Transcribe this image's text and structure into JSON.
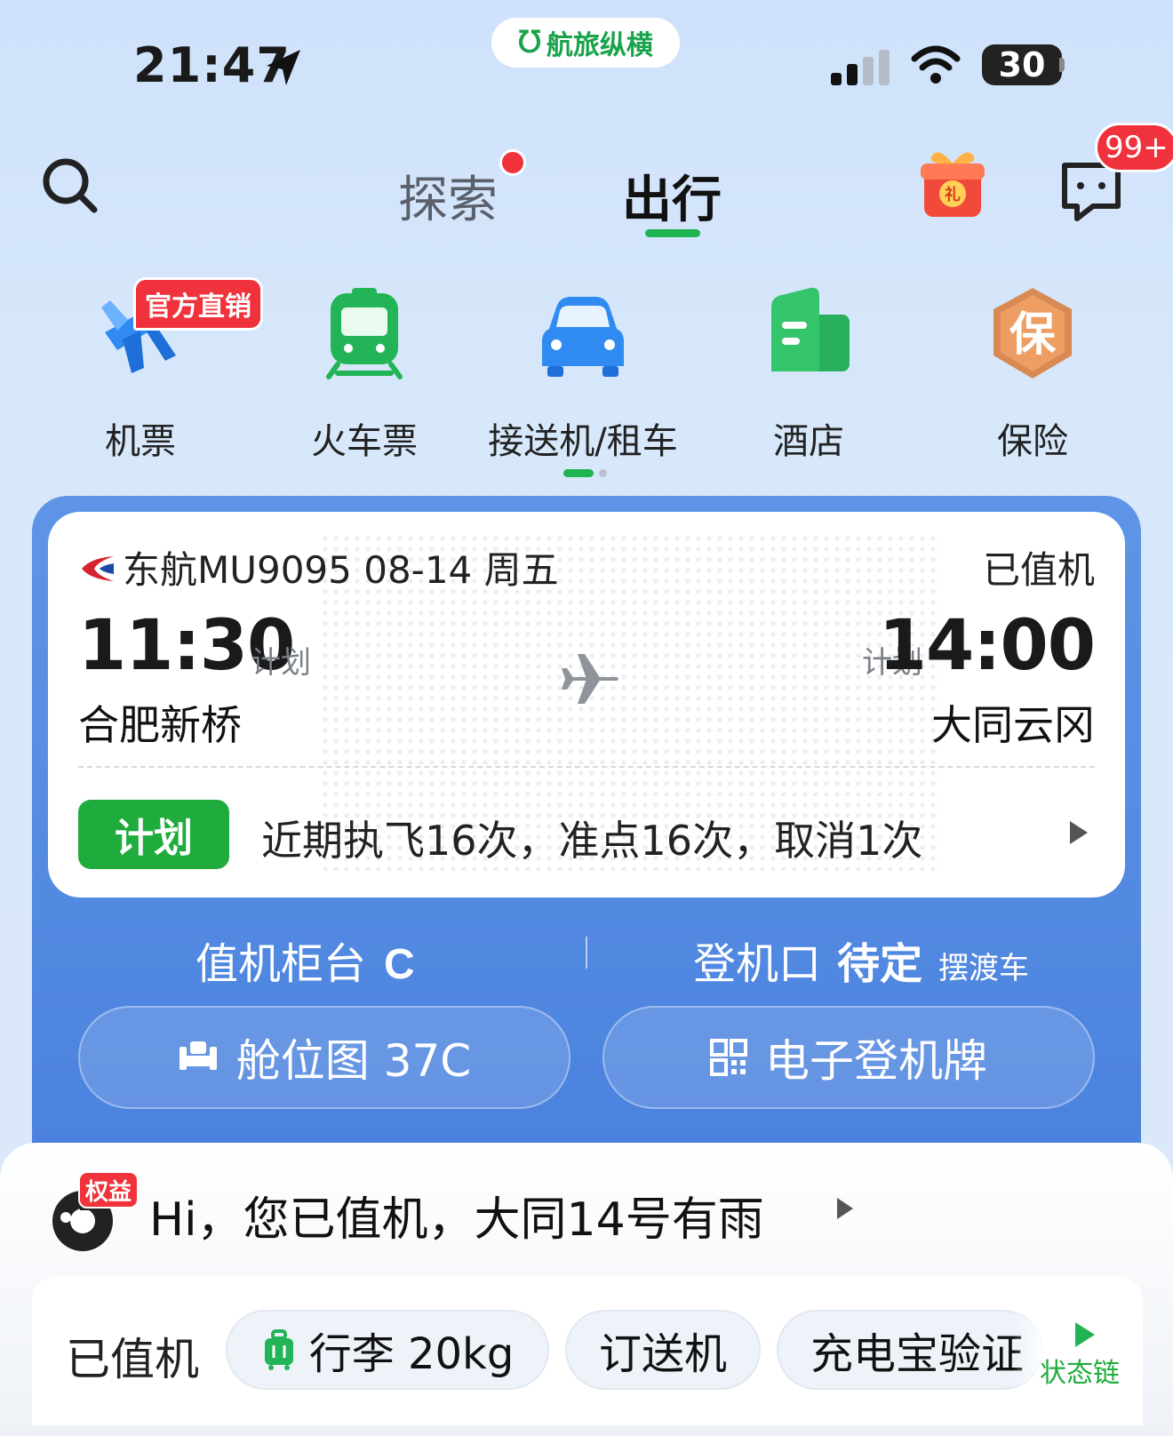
{
  "status_bar": {
    "time": "21:47",
    "app_pill": "航旅纵横",
    "battery": "30"
  },
  "nav": {
    "tab_explore": "探索",
    "tab_travel": "出行",
    "message_badge": "99+"
  },
  "services": {
    "official_tag": "官方直销",
    "items": [
      {
        "label": "机票",
        "icon": "airplane-icon"
      },
      {
        "label": "火车票",
        "icon": "train-icon"
      },
      {
        "label": "接送机/租车",
        "icon": "car-icon"
      },
      {
        "label": "酒店",
        "icon": "hotel-icon"
      },
      {
        "label": "保险",
        "icon": "insurance-icon"
      }
    ],
    "insurance_glyph": "保"
  },
  "flight": {
    "info": "东航MU9095 08-14 周五",
    "status": "已值机",
    "departure": {
      "time": "11:30",
      "plan_label": "计划",
      "city": "合肥新桥"
    },
    "arrival": {
      "time": "14:00",
      "plan_label": "计划",
      "city": "大同云冈"
    },
    "plan_tag": "计划",
    "stats": "近期执飞16次，准点16次，取消1次",
    "counter_label": "值机柜台",
    "counter_value": "C",
    "gate_label": "登机口",
    "gate_value": "待定",
    "gate_note": "摆渡车",
    "seat_button": "舱位图 37C",
    "boarding_pass_button": "电子登机牌"
  },
  "assistant": {
    "rights_tag": "权益",
    "message": "Hi，您已值机，大同14号有雨"
  },
  "status_chain": {
    "label": "已值机",
    "chips": [
      "行李 20kg",
      "订送机",
      "充电宝验证"
    ],
    "chain_label": "状态链"
  },
  "colors": {
    "accent_green": "#1fb451",
    "red": "#f0323c",
    "flight_blue": "#4b82de"
  }
}
